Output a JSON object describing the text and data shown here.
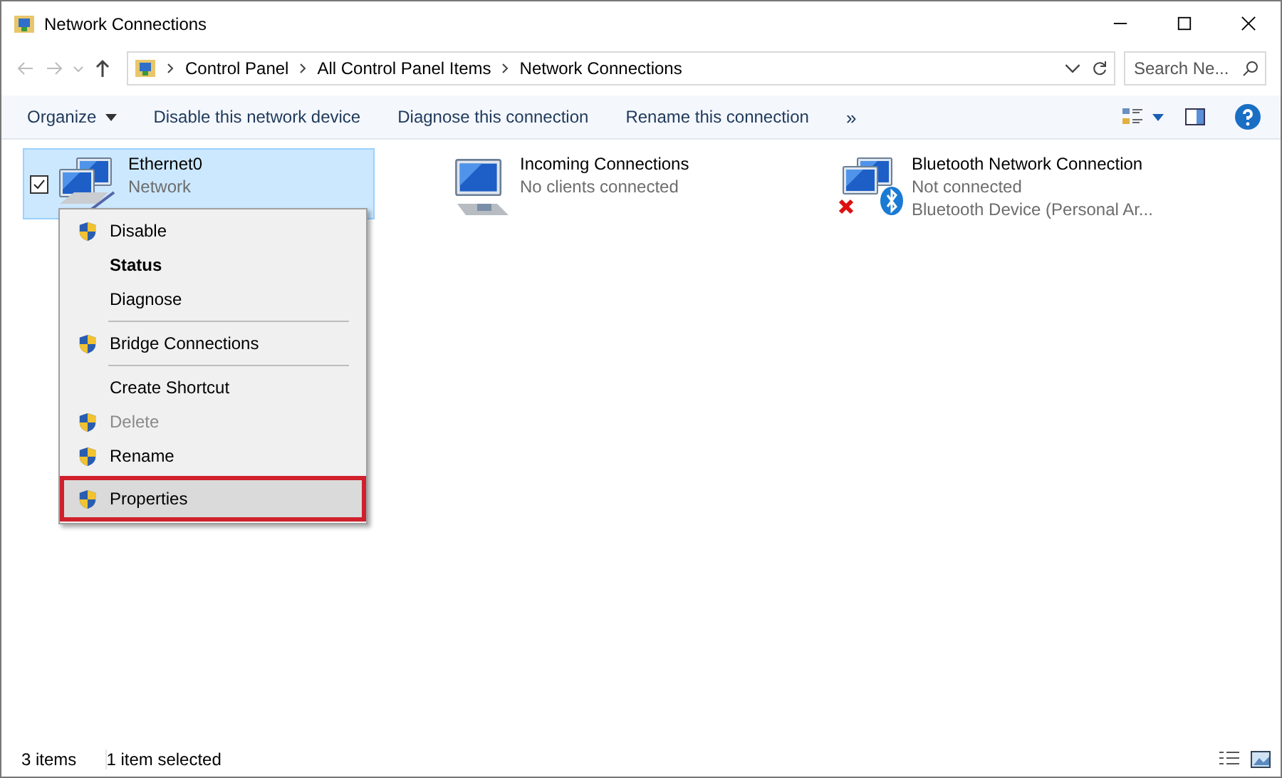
{
  "window": {
    "title": "Network Connections"
  },
  "address": {
    "crumbs": [
      "Control Panel",
      "All Control Panel Items",
      "Network Connections"
    ],
    "search_placeholder": "Search Ne..."
  },
  "toolbar": {
    "buttons": [
      {
        "label": "Organize",
        "dropdown": true
      },
      {
        "label": "Disable this network device",
        "dropdown": false
      },
      {
        "label": "Diagnose this connection",
        "dropdown": false
      },
      {
        "label": "Rename this connection",
        "dropdown": false
      }
    ],
    "more": "»"
  },
  "connections": [
    {
      "name": "Ethernet0",
      "status": "Network",
      "kind": "ethernet",
      "selected": true,
      "checked": true
    },
    {
      "name": "Incoming Connections",
      "status": "No clients connected",
      "kind": "incoming",
      "selected": false,
      "checked": false
    },
    {
      "name": "Bluetooth Network Connection",
      "status": "Not connected",
      "device": "Bluetooth Device (Personal Ar...",
      "kind": "bluetooth",
      "selected": false,
      "checked": false
    }
  ],
  "context_menu": [
    {
      "label": "Disable",
      "shield": true,
      "bold": false,
      "disabled": false,
      "separator_before": false,
      "selected": false
    },
    {
      "label": "Status",
      "shield": false,
      "bold": true,
      "disabled": false,
      "separator_before": false,
      "selected": false
    },
    {
      "label": "Diagnose",
      "shield": false,
      "bold": false,
      "disabled": false,
      "separator_before": false,
      "selected": false
    },
    {
      "label": "Bridge Connections",
      "shield": true,
      "bold": false,
      "disabled": false,
      "separator_before": true,
      "selected": false
    },
    {
      "label": "Create Shortcut",
      "shield": false,
      "bold": false,
      "disabled": false,
      "separator_before": true,
      "selected": false
    },
    {
      "label": "Delete",
      "shield": true,
      "bold": false,
      "disabled": true,
      "separator_before": false,
      "selected": false
    },
    {
      "label": "Rename",
      "shield": true,
      "bold": false,
      "disabled": false,
      "separator_before": false,
      "selected": false
    },
    {
      "label": "Properties",
      "shield": true,
      "bold": false,
      "disabled": false,
      "separator_before": false,
      "selected": true
    }
  ],
  "status_bar": {
    "count": "3 items",
    "selection": "1 item selected"
  }
}
